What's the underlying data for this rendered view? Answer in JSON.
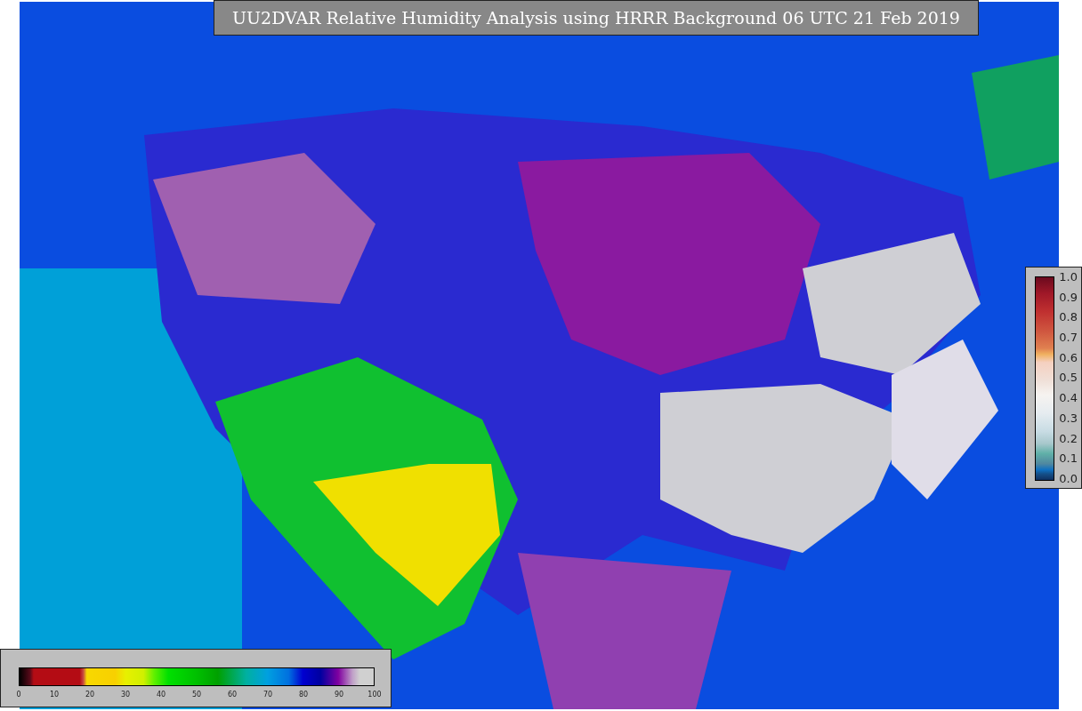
{
  "title": "UU2DVAR Relative Humidity Analysis using HRRR Background 06 UTC 21 Feb 2019",
  "humidity_scale": {
    "ticks": [
      "0",
      "10",
      "20",
      "30",
      "40",
      "50",
      "60",
      "70",
      "80",
      "90",
      "100"
    ]
  },
  "observation_scale": {
    "ticks": [
      "1.0",
      "0.9",
      "0.8",
      "0.7",
      "0.6",
      "0.5",
      "0.4",
      "0.3",
      "0.2",
      "0.1",
      "0.0"
    ]
  }
}
